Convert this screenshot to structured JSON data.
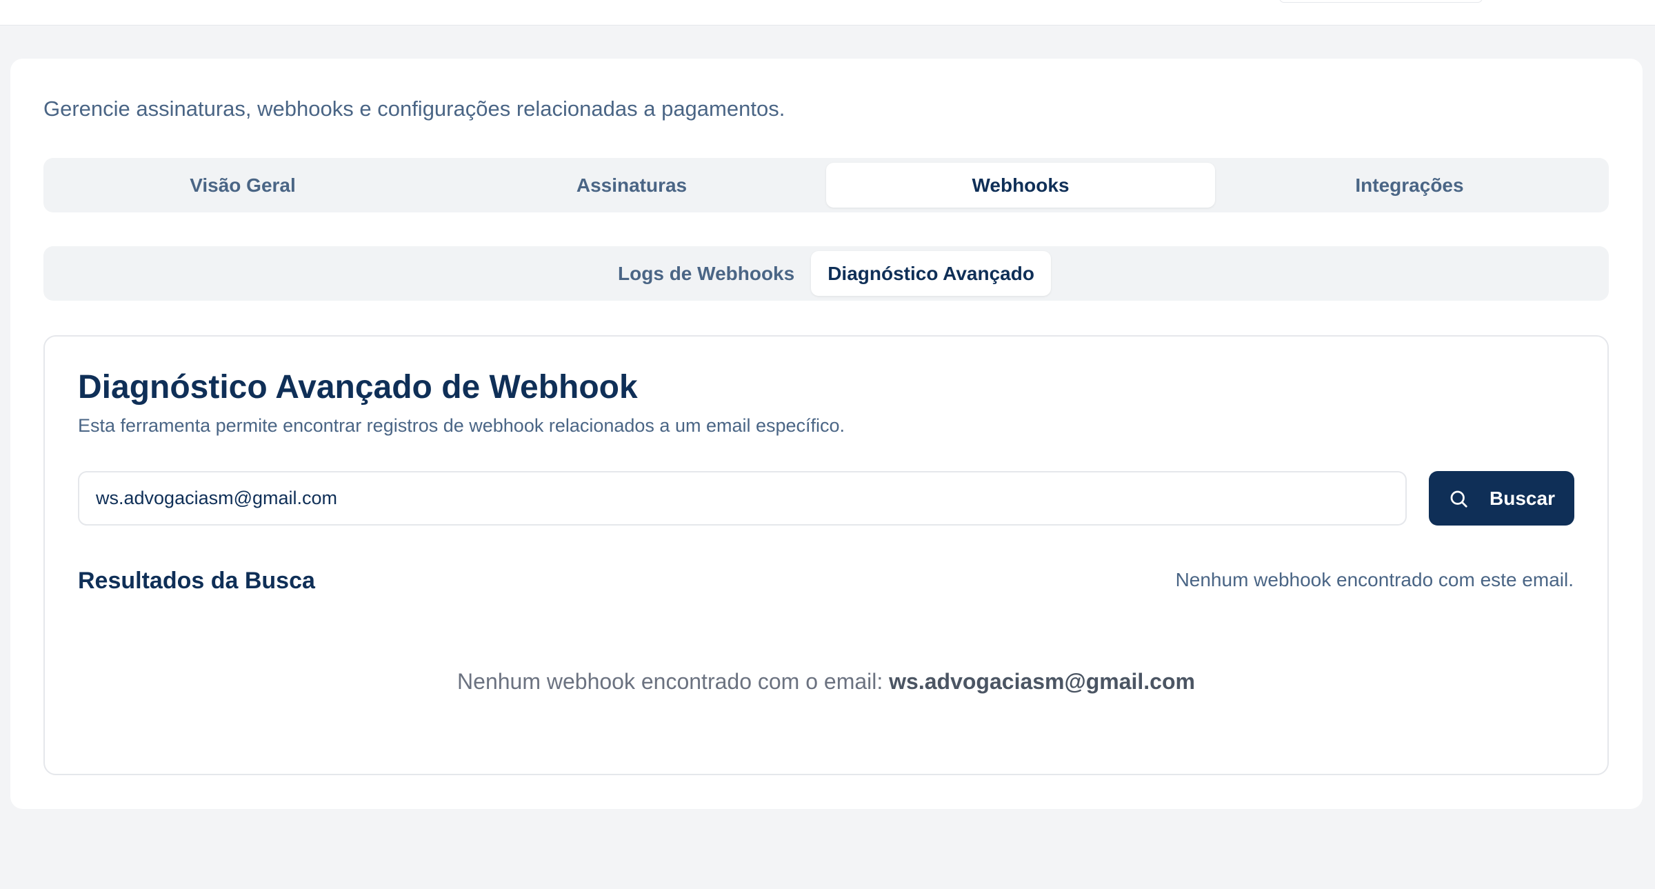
{
  "header": {
    "subtitle": "Gerencie assinaturas, webhooks e configurações relacionadas a pagamentos."
  },
  "tabs": [
    {
      "label": "Visão Geral",
      "active": false
    },
    {
      "label": "Assinaturas",
      "active": false
    },
    {
      "label": "Webhooks",
      "active": true
    },
    {
      "label": "Integrações",
      "active": false
    }
  ],
  "subtabs": [
    {
      "label": "Logs de Webhooks",
      "active": false
    },
    {
      "label": "Diagnóstico Avançado",
      "active": true
    }
  ],
  "diagnostic": {
    "title": "Diagnóstico Avançado de Webhook",
    "description": "Esta ferramenta permite encontrar registros de webhook relacionados a um email específico.",
    "search": {
      "value": "ws.advogaciasm@gmail.com",
      "button_label": "Buscar",
      "button_icon": "search-icon"
    },
    "results": {
      "title": "Resultados da Busca",
      "status": "Nenhum webhook encontrado com este email.",
      "empty_prefix": "Nenhum webhook encontrado com o email:",
      "empty_email": "ws.advogaciasm@gmail.com"
    }
  },
  "colors": {
    "primary": "#0f2f57",
    "muted_text": "#4a6585",
    "tab_background": "#f1f3f5",
    "page_background": "#f3f4f6"
  }
}
